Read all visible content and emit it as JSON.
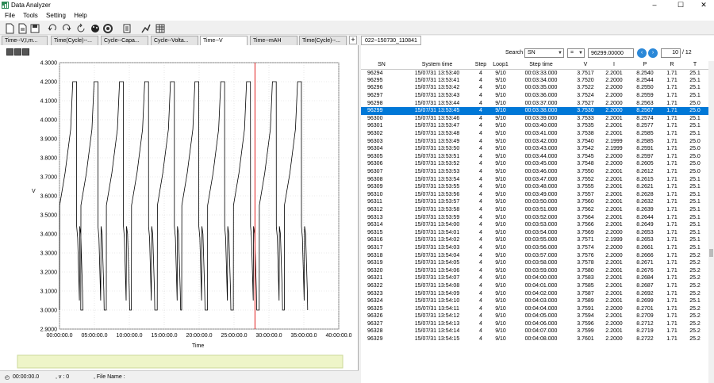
{
  "window": {
    "title": "Data Analyzer",
    "min": "–",
    "max": "☐",
    "close": "✕"
  },
  "menu": [
    "File",
    "Tools",
    "Setting",
    "Help"
  ],
  "toolbar_icons": [
    "new-file-icon",
    "open-file-icon",
    "save-icon",
    "undo-icon",
    "redo-icon",
    "refresh-icon",
    "color-palette-icon",
    "settings-icon",
    "document-icon",
    "line-chart-icon",
    "table-icon"
  ],
  "tabs": [
    "Time--V,I,m...",
    "Time(Cycle)--...",
    "Cycle--Capa...",
    "Cycle--Volta...",
    "Time--V",
    "Time--mAH",
    "Time(Cycle)--..."
  ],
  "active_tab": "Time--V",
  "tab_add": "+",
  "chart_data": {
    "type": "line",
    "ylabel": "V",
    "xlabel": "Time",
    "ylim": [
      2.9,
      4.3
    ],
    "yticks": [
      "4.3000",
      "4.2000",
      "4.1000",
      "4.0000",
      "3.9000",
      "3.8000",
      "3.7000",
      "3.6000",
      "3.5000",
      "3.4000",
      "3.3000",
      "3.2000",
      "3.1000",
      "3.0000",
      "2.9000"
    ],
    "xticks": [
      "00:00:00.0",
      "05:00:00.0",
      "10:00:00.0",
      "15:00:00.0",
      "20:00:00.0",
      "25:00:00.0",
      "30:00:00.0",
      "35:00:00.0",
      "40:00:00.0"
    ],
    "xlim_hours": [
      0,
      40
    ],
    "cursor_hour": 28,
    "cycle_starts_hours": [
      0,
      3.05,
      6.7,
      10.3,
      14.0,
      17.5,
      21.2,
      24.9,
      28.6,
      32.2
    ],
    "cycle_period_hours": 3.65,
    "grid": true,
    "line_color": "#000000",
    "cursor_color": "#e02020"
  },
  "overview": {
    "ticks": [
      "00:00:00.0",
      "05:00:00.0",
      "10:00:00.0",
      "15:00:00.0",
      "20:00:00.0",
      "25:00:00.0",
      "30:00:00.0",
      "35:00:00.0",
      "40:00:00.0"
    ]
  },
  "status": {
    "time": "00:00:00.0",
    "v": ", v : 0",
    "file": ", File Name :"
  },
  "file_tab": "022~150730_110841",
  "search": {
    "label": "Search",
    "field": "SN",
    "op": "=",
    "value": "96299.00000",
    "page": "10",
    "total": "/ 12"
  },
  "columns": [
    "SN",
    "System time",
    "Step",
    "Loop1",
    "Step time",
    "V",
    "I",
    "P",
    "R",
    "T"
  ],
  "selected_sn": "96299",
  "rows": [
    [
      "96294",
      "15/07/31 13:53:40",
      "4",
      "9/10",
      "00:03:33.000",
      "3.7517",
      "2.2001",
      "8.2540",
      "1.71",
      "25.1"
    ],
    [
      "96295",
      "15/07/31 13:53:41",
      "4",
      "9/10",
      "00:03:34.000",
      "3.7520",
      "2.2000",
      "8.2544",
      "1.71",
      "25.1"
    ],
    [
      "96296",
      "15/07/31 13:53:42",
      "4",
      "9/10",
      "00:03:35.000",
      "3.7522",
      "2.2000",
      "8.2550",
      "1.71",
      "25.1"
    ],
    [
      "96297",
      "15/07/31 13:53:43",
      "4",
      "9/10",
      "00:03:36.000",
      "3.7524",
      "2.2000",
      "8.2559",
      "1.71",
      "25.1"
    ],
    [
      "96298",
      "15/07/31 13:53:44",
      "4",
      "9/10",
      "00:03:37.000",
      "3.7527",
      "2.2000",
      "8.2563",
      "1.71",
      "25.0"
    ],
    [
      "96299",
      "15/07/31 13:53:45",
      "4",
      "9/10",
      "00:03:38.000",
      "3.7530",
      "2.2000",
      "8.2567",
      "1.71",
      "25.0"
    ],
    [
      "96300",
      "15/07/31 13:53:46",
      "4",
      "9/10",
      "00:03:39.000",
      "3.7533",
      "2.2001",
      "8.2574",
      "1.71",
      "25.1"
    ],
    [
      "96301",
      "15/07/31 13:53:47",
      "4",
      "9/10",
      "00:03:40.000",
      "3.7535",
      "2.2001",
      "8.2577",
      "1.71",
      "25.1"
    ],
    [
      "96302",
      "15/07/31 13:53:48",
      "4",
      "9/10",
      "00:03:41.000",
      "3.7538",
      "2.2001",
      "8.2585",
      "1.71",
      "25.1"
    ],
    [
      "96303",
      "15/07/31 13:53:49",
      "4",
      "9/10",
      "00:03:42.000",
      "3.7540",
      "2.1999",
      "8.2585",
      "1.71",
      "25.0"
    ],
    [
      "96304",
      "15/07/31 13:53:50",
      "4",
      "9/10",
      "00:03:43.000",
      "3.7542",
      "2.1999",
      "8.2591",
      "1.71",
      "25.0"
    ],
    [
      "96305",
      "15/07/31 13:53:51",
      "4",
      "9/10",
      "00:03:44.000",
      "3.7545",
      "2.2000",
      "8.2597",
      "1.71",
      "25.0"
    ],
    [
      "96306",
      "15/07/31 13:53:52",
      "4",
      "9/10",
      "00:03:45.000",
      "3.7548",
      "2.2000",
      "8.2605",
      "1.71",
      "25.0"
    ],
    [
      "96307",
      "15/07/31 13:53:53",
      "4",
      "9/10",
      "00:03:46.000",
      "3.7550",
      "2.2001",
      "8.2612",
      "1.71",
      "25.0"
    ],
    [
      "96308",
      "15/07/31 13:53:54",
      "4",
      "9/10",
      "00:03:47.000",
      "3.7552",
      "2.2001",
      "8.2615",
      "1.71",
      "25.1"
    ],
    [
      "96309",
      "15/07/31 13:53:55",
      "4",
      "9/10",
      "00:03:48.000",
      "3.7555",
      "2.2001",
      "8.2621",
      "1.71",
      "25.1"
    ],
    [
      "96310",
      "15/07/31 13:53:56",
      "4",
      "9/10",
      "00:03:49.000",
      "3.7557",
      "2.2001",
      "8.2628",
      "1.71",
      "25.1"
    ],
    [
      "96311",
      "15/07/31 13:53:57",
      "4",
      "9/10",
      "00:03:50.000",
      "3.7560",
      "2.2001",
      "8.2632",
      "1.71",
      "25.1"
    ],
    [
      "96312",
      "15/07/31 13:53:58",
      "4",
      "9/10",
      "00:03:51.000",
      "3.7562",
      "2.2001",
      "8.2639",
      "1.71",
      "25.1"
    ],
    [
      "96313",
      "15/07/31 13:53:59",
      "4",
      "9/10",
      "00:03:52.000",
      "3.7564",
      "2.2001",
      "8.2644",
      "1.71",
      "25.1"
    ],
    [
      "96314",
      "15/07/31 13:54:00",
      "4",
      "9/10",
      "00:03:53.000",
      "3.7566",
      "2.2001",
      "8.2649",
      "1.71",
      "25.1"
    ],
    [
      "96315",
      "15/07/31 13:54:01",
      "4",
      "9/10",
      "00:03:54.000",
      "3.7569",
      "2.2000",
      "8.2653",
      "1.71",
      "25.1"
    ],
    [
      "96316",
      "15/07/31 13:54:02",
      "4",
      "9/10",
      "00:03:55.000",
      "3.7571",
      "2.1999",
      "8.2653",
      "1.71",
      "25.1"
    ],
    [
      "96317",
      "15/07/31 13:54:03",
      "4",
      "9/10",
      "00:03:56.000",
      "3.7574",
      "2.2000",
      "8.2661",
      "1.71",
      "25.1"
    ],
    [
      "96318",
      "15/07/31 13:54:04",
      "4",
      "9/10",
      "00:03:57.000",
      "3.7576",
      "2.2000",
      "8.2666",
      "1.71",
      "25.2"
    ],
    [
      "96319",
      "15/07/31 13:54:05",
      "4",
      "9/10",
      "00:03:58.000",
      "3.7578",
      "2.2001",
      "8.2671",
      "1.71",
      "25.2"
    ],
    [
      "96320",
      "15/07/31 13:54:06",
      "4",
      "9/10",
      "00:03:59.000",
      "3.7580",
      "2.2001",
      "8.2676",
      "1.71",
      "25.2"
    ],
    [
      "96321",
      "15/07/31 13:54:07",
      "4",
      "9/10",
      "00:04:00.000",
      "3.7583",
      "2.2001",
      "8.2684",
      "1.71",
      "25.2"
    ],
    [
      "96322",
      "15/07/31 13:54:08",
      "4",
      "9/10",
      "00:04:01.000",
      "3.7585",
      "2.2001",
      "8.2687",
      "1.71",
      "25.2"
    ],
    [
      "96323",
      "15/07/31 13:54:09",
      "4",
      "9/10",
      "00:04:02.000",
      "3.7587",
      "2.2001",
      "8.2692",
      "1.71",
      "25.2"
    ],
    [
      "96324",
      "15/07/31 13:54:10",
      "4",
      "9/10",
      "00:04:03.000",
      "3.7589",
      "2.2001",
      "8.2699",
      "1.71",
      "25.1"
    ],
    [
      "96325",
      "15/07/31 13:54:11",
      "4",
      "9/10",
      "00:04:04.000",
      "3.7591",
      "2.2000",
      "8.2701",
      "1.71",
      "25.2"
    ],
    [
      "96326",
      "15/07/31 13:54:12",
      "4",
      "9/10",
      "00:04:05.000",
      "3.7594",
      "2.2001",
      "8.2709",
      "1.71",
      "25.2"
    ],
    [
      "96327",
      "15/07/31 13:54:13",
      "4",
      "9/10",
      "00:04:06.000",
      "3.7596",
      "2.2000",
      "8.2712",
      "1.71",
      "25.2"
    ],
    [
      "96328",
      "15/07/31 13:54:14",
      "4",
      "9/10",
      "00:04:07.000",
      "3.7599",
      "2.2001",
      "8.2719",
      "1.71",
      "25.2"
    ],
    [
      "96329",
      "15/07/31 13:54:15",
      "4",
      "9/10",
      "00:04:08.000",
      "3.7601",
      "2.2000",
      "8.2722",
      "1.71",
      "25.2"
    ]
  ]
}
